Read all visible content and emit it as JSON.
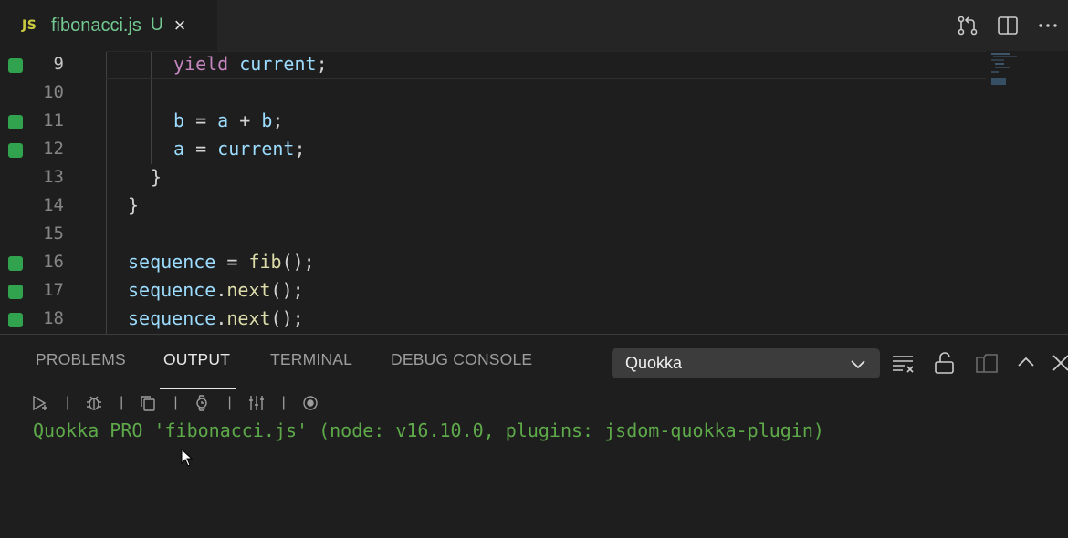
{
  "tab": {
    "lang_badge": "JS",
    "filename": "fibonacci.js",
    "status": "U",
    "close": "×"
  },
  "tab_actions": [
    "open-changes-icon",
    "split-editor-icon",
    "more-actions-icon"
  ],
  "editor": {
    "lines": [
      {
        "num": "9",
        "modified": true
      },
      {
        "num": "10",
        "modified": false
      },
      {
        "num": "11",
        "modified": true
      },
      {
        "num": "12",
        "modified": true
      },
      {
        "num": "13",
        "modified": false
      },
      {
        "num": "14",
        "modified": false
      },
      {
        "num": "15",
        "modified": false
      },
      {
        "num": "16",
        "modified": true
      },
      {
        "num": "17",
        "modified": true
      },
      {
        "num": "18",
        "modified": true
      }
    ],
    "code": {
      "l9_kw": "yield",
      "l9_var": "current",
      "l9_end": ";",
      "l11_b": "b",
      "l11_eq": " = ",
      "l11_a": "a",
      "l11_plus": " + ",
      "l11_b2": "b",
      "l11_end": ";",
      "l12_a": "a",
      "l12_eq": " = ",
      "l12_cur": "current",
      "l12_end": ";",
      "l13": "}",
      "l14": "}",
      "l16_var": "sequence",
      "l16_eq": " = ",
      "l16_fn": "fib",
      "l16_end": "();",
      "l17_var": "sequence",
      "l17_dot": ".",
      "l17_fn": "next",
      "l17_end": "();",
      "l18_var": "sequence",
      "l18_dot": ".",
      "l18_fn": "next",
      "l18_end": "();"
    },
    "git_added_color": "#31a34e"
  },
  "panel": {
    "tabs": [
      "PROBLEMS",
      "OUTPUT",
      "TERMINAL",
      "DEBUG CONSOLE"
    ],
    "active_tab": "OUTPUT",
    "channel_select": "Quokka",
    "actions": [
      "clear-output-icon",
      "lock-scroll-icon",
      "open-log-icon",
      "maximize-panel-icon",
      "close-panel-icon"
    ],
    "toolbar_icons": [
      "run-icon",
      "debug-icon",
      "copy-icon",
      "watch-icon",
      "settings-icon",
      "record-icon"
    ],
    "toolbar_sep": "|",
    "output_text": "Quokka PRO 'fibonacci.js' (node: v16.10.0, plugins: jsdom-quokka-plugin)",
    "output_color": "#5eaa4a"
  }
}
